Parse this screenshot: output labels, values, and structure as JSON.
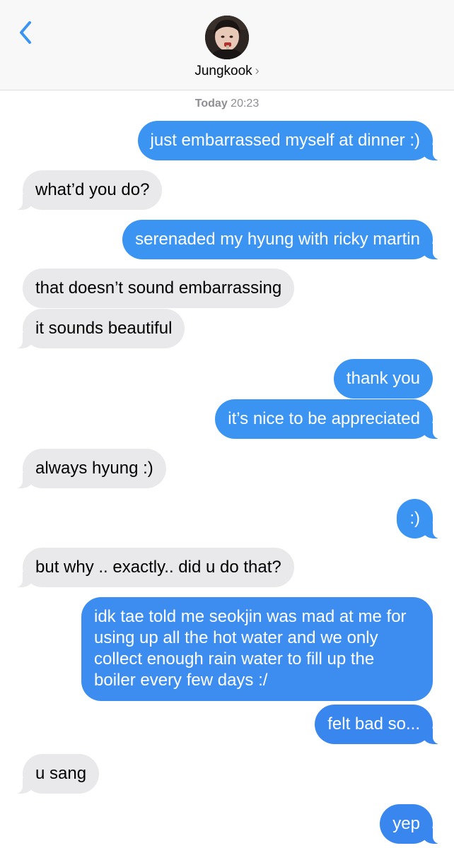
{
  "header": {
    "contact_name": "Jungkook",
    "chevron": "›",
    "back_icon": "chevron-left-icon",
    "accent_color": "#3b94f2"
  },
  "timestamp": {
    "day": "Today",
    "time": "20:23"
  },
  "messages": [
    {
      "from": "me",
      "text": "just embarrassed myself at dinner :)"
    },
    {
      "from": "them",
      "text": "what’d you do?"
    },
    {
      "from": "me",
      "text": "serenaded my hyung with ricky martin"
    },
    {
      "from": "them",
      "text": "that doesn’t sound embarrassing"
    },
    {
      "from": "them",
      "text": "it sounds beautiful"
    },
    {
      "from": "me",
      "text": "thank you"
    },
    {
      "from": "me",
      "text": "it’s nice to be appreciated"
    },
    {
      "from": "them",
      "text": "always hyung :)"
    },
    {
      "from": "me",
      "text": ":)"
    },
    {
      "from": "them",
      "text": "but why .. exactly.. did u do that?"
    },
    {
      "from": "me",
      "text": "idk tae told me seokjin was mad at me for using up all the hot water and we only collect enough rain water to fill up the boiler every few days :/"
    },
    {
      "from": "me",
      "text": "felt bad so..."
    },
    {
      "from": "them",
      "text": "u sang"
    },
    {
      "from": "me",
      "text": "yep"
    }
  ]
}
